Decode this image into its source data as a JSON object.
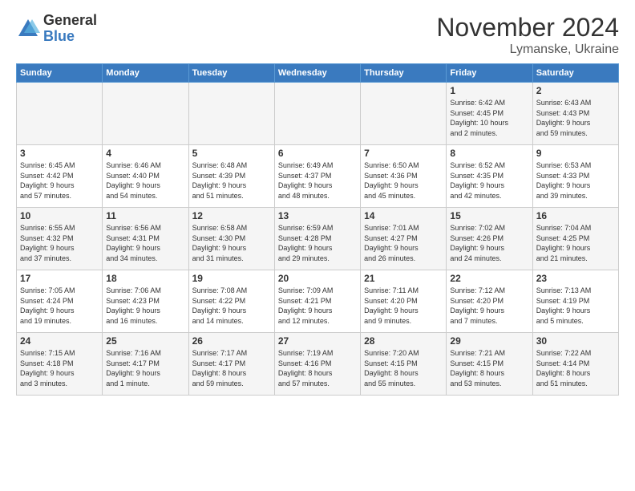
{
  "logo": {
    "general": "General",
    "blue": "Blue"
  },
  "header": {
    "month": "November 2024",
    "location": "Lymanske, Ukraine"
  },
  "weekdays": [
    "Sunday",
    "Monday",
    "Tuesday",
    "Wednesday",
    "Thursday",
    "Friday",
    "Saturday"
  ],
  "weeks": [
    [
      {
        "day": "",
        "info": ""
      },
      {
        "day": "",
        "info": ""
      },
      {
        "day": "",
        "info": ""
      },
      {
        "day": "",
        "info": ""
      },
      {
        "day": "",
        "info": ""
      },
      {
        "day": "1",
        "info": "Sunrise: 6:42 AM\nSunset: 4:45 PM\nDaylight: 10 hours\nand 2 minutes."
      },
      {
        "day": "2",
        "info": "Sunrise: 6:43 AM\nSunset: 4:43 PM\nDaylight: 9 hours\nand 59 minutes."
      }
    ],
    [
      {
        "day": "3",
        "info": "Sunrise: 6:45 AM\nSunset: 4:42 PM\nDaylight: 9 hours\nand 57 minutes."
      },
      {
        "day": "4",
        "info": "Sunrise: 6:46 AM\nSunset: 4:40 PM\nDaylight: 9 hours\nand 54 minutes."
      },
      {
        "day": "5",
        "info": "Sunrise: 6:48 AM\nSunset: 4:39 PM\nDaylight: 9 hours\nand 51 minutes."
      },
      {
        "day": "6",
        "info": "Sunrise: 6:49 AM\nSunset: 4:37 PM\nDaylight: 9 hours\nand 48 minutes."
      },
      {
        "day": "7",
        "info": "Sunrise: 6:50 AM\nSunset: 4:36 PM\nDaylight: 9 hours\nand 45 minutes."
      },
      {
        "day": "8",
        "info": "Sunrise: 6:52 AM\nSunset: 4:35 PM\nDaylight: 9 hours\nand 42 minutes."
      },
      {
        "day": "9",
        "info": "Sunrise: 6:53 AM\nSunset: 4:33 PM\nDaylight: 9 hours\nand 39 minutes."
      }
    ],
    [
      {
        "day": "10",
        "info": "Sunrise: 6:55 AM\nSunset: 4:32 PM\nDaylight: 9 hours\nand 37 minutes."
      },
      {
        "day": "11",
        "info": "Sunrise: 6:56 AM\nSunset: 4:31 PM\nDaylight: 9 hours\nand 34 minutes."
      },
      {
        "day": "12",
        "info": "Sunrise: 6:58 AM\nSunset: 4:30 PM\nDaylight: 9 hours\nand 31 minutes."
      },
      {
        "day": "13",
        "info": "Sunrise: 6:59 AM\nSunset: 4:28 PM\nDaylight: 9 hours\nand 29 minutes."
      },
      {
        "day": "14",
        "info": "Sunrise: 7:01 AM\nSunset: 4:27 PM\nDaylight: 9 hours\nand 26 minutes."
      },
      {
        "day": "15",
        "info": "Sunrise: 7:02 AM\nSunset: 4:26 PM\nDaylight: 9 hours\nand 24 minutes."
      },
      {
        "day": "16",
        "info": "Sunrise: 7:04 AM\nSunset: 4:25 PM\nDaylight: 9 hours\nand 21 minutes."
      }
    ],
    [
      {
        "day": "17",
        "info": "Sunrise: 7:05 AM\nSunset: 4:24 PM\nDaylight: 9 hours\nand 19 minutes."
      },
      {
        "day": "18",
        "info": "Sunrise: 7:06 AM\nSunset: 4:23 PM\nDaylight: 9 hours\nand 16 minutes."
      },
      {
        "day": "19",
        "info": "Sunrise: 7:08 AM\nSunset: 4:22 PM\nDaylight: 9 hours\nand 14 minutes."
      },
      {
        "day": "20",
        "info": "Sunrise: 7:09 AM\nSunset: 4:21 PM\nDaylight: 9 hours\nand 12 minutes."
      },
      {
        "day": "21",
        "info": "Sunrise: 7:11 AM\nSunset: 4:20 PM\nDaylight: 9 hours\nand 9 minutes."
      },
      {
        "day": "22",
        "info": "Sunrise: 7:12 AM\nSunset: 4:20 PM\nDaylight: 9 hours\nand 7 minutes."
      },
      {
        "day": "23",
        "info": "Sunrise: 7:13 AM\nSunset: 4:19 PM\nDaylight: 9 hours\nand 5 minutes."
      }
    ],
    [
      {
        "day": "24",
        "info": "Sunrise: 7:15 AM\nSunset: 4:18 PM\nDaylight: 9 hours\nand 3 minutes."
      },
      {
        "day": "25",
        "info": "Sunrise: 7:16 AM\nSunset: 4:17 PM\nDaylight: 9 hours\nand 1 minute."
      },
      {
        "day": "26",
        "info": "Sunrise: 7:17 AM\nSunset: 4:17 PM\nDaylight: 8 hours\nand 59 minutes."
      },
      {
        "day": "27",
        "info": "Sunrise: 7:19 AM\nSunset: 4:16 PM\nDaylight: 8 hours\nand 57 minutes."
      },
      {
        "day": "28",
        "info": "Sunrise: 7:20 AM\nSunset: 4:15 PM\nDaylight: 8 hours\nand 55 minutes."
      },
      {
        "day": "29",
        "info": "Sunrise: 7:21 AM\nSunset: 4:15 PM\nDaylight: 8 hours\nand 53 minutes."
      },
      {
        "day": "30",
        "info": "Sunrise: 7:22 AM\nSunset: 4:14 PM\nDaylight: 8 hours\nand 51 minutes."
      }
    ]
  ]
}
